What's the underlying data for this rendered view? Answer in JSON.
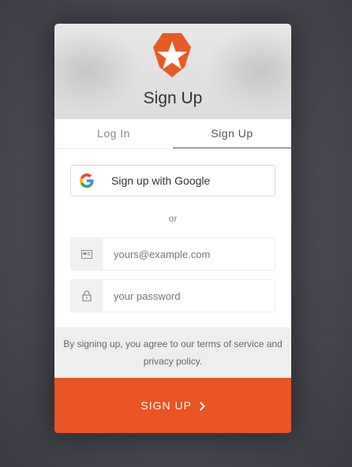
{
  "header": {
    "title": "Sign Up"
  },
  "tabs": [
    {
      "label": "Log In",
      "active": false
    },
    {
      "label": "Sign Up",
      "active": true
    }
  ],
  "social": {
    "google_label": "Sign up with Google"
  },
  "separator": "or",
  "form": {
    "email": {
      "placeholder": "yours@example.com",
      "value": ""
    },
    "password": {
      "placeholder": "your password",
      "value": ""
    }
  },
  "terms": {
    "line1": "By signing up, you agree to our terms of service and",
    "line2": "privacy policy."
  },
  "submit": {
    "label": "SIGN UP"
  },
  "colors": {
    "accent": "#ea5323",
    "background": "#4a4b53",
    "header": "#dedede",
    "terms_bg": "#eeeeee"
  },
  "icons": {
    "logo": "shield-star-logo",
    "google": "google-g-icon",
    "email": "envelope-card-icon",
    "password": "lock-icon",
    "submit": "chevron-right-icon"
  }
}
